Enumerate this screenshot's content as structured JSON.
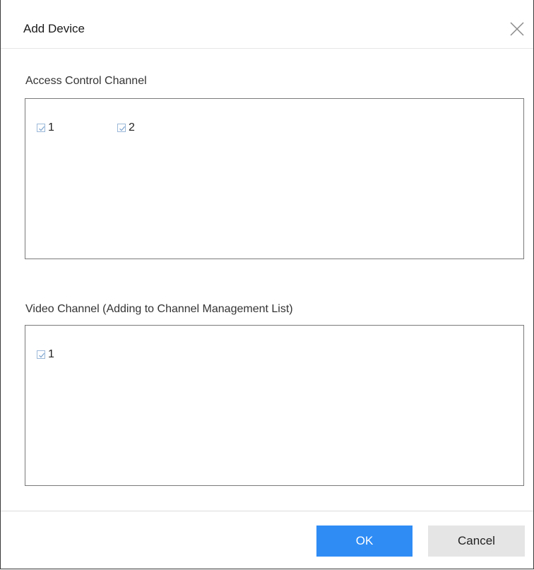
{
  "dialog": {
    "title": "Add Device",
    "close_icon": "close-icon"
  },
  "access_control": {
    "label": "Access Control Channel",
    "channels": [
      {
        "label": "1",
        "checked": true
      },
      {
        "label": "2",
        "checked": true
      }
    ]
  },
  "video": {
    "label": "Video Channel (Adding to Channel Management List)",
    "channels": [
      {
        "label": "1",
        "checked": true
      }
    ]
  },
  "footer": {
    "ok_label": "OK",
    "cancel_label": "Cancel"
  },
  "colors": {
    "primary": "#2f8cf5",
    "checkbox_border": "#9bb8d8"
  }
}
